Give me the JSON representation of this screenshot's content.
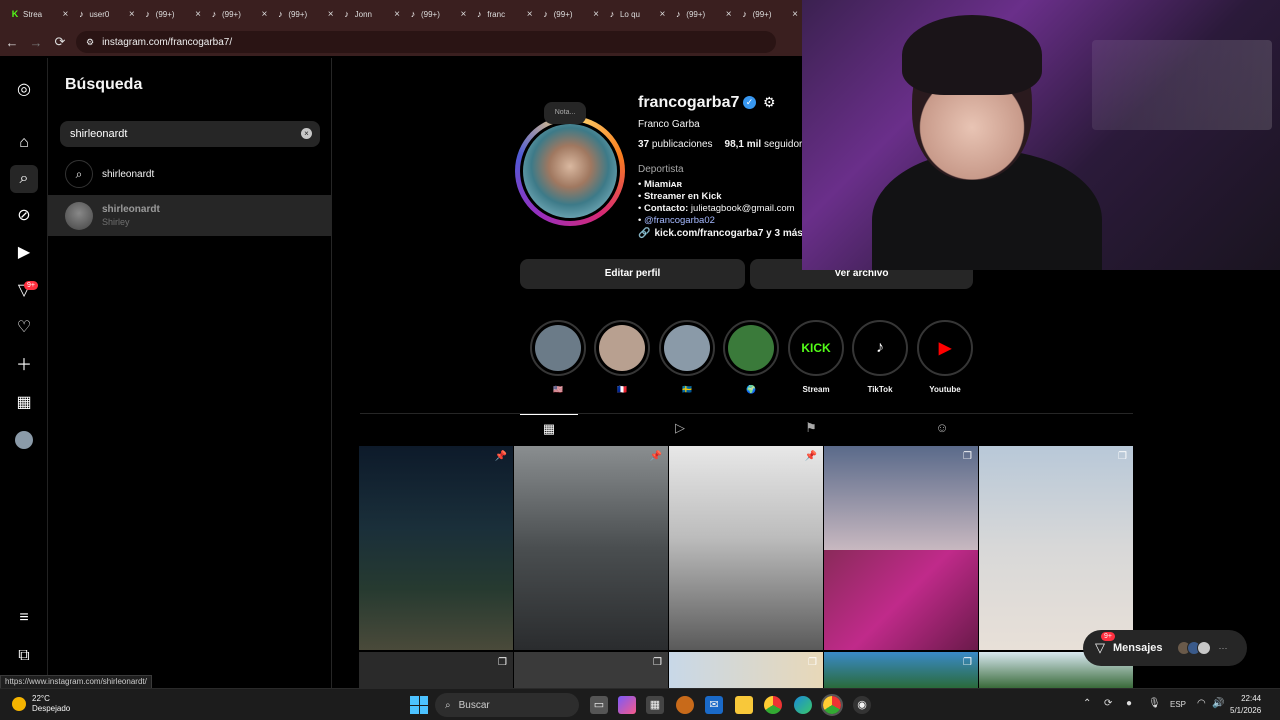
{
  "browser": {
    "tabs": [
      {
        "icon": "K",
        "title": "Strea",
        "kind": "kick"
      },
      {
        "icon": "♪",
        "title": "user0",
        "kind": "tiktok"
      },
      {
        "icon": "♪",
        "title": "(99+)",
        "kind": "tiktok"
      },
      {
        "icon": "♪",
        "title": "(99+)",
        "kind": "tiktok"
      },
      {
        "icon": "♪",
        "title": "(99+)",
        "kind": "tiktok"
      },
      {
        "icon": "♪",
        "title": "Jonn",
        "kind": "tiktok"
      },
      {
        "icon": "♪",
        "title": "(99+)",
        "kind": "tiktok"
      },
      {
        "icon": "♪",
        "title": "franc",
        "kind": "tiktok"
      },
      {
        "icon": "♪",
        "title": "(99+)",
        "kind": "tiktok"
      },
      {
        "icon": "♪",
        "title": "Lo qu",
        "kind": "tiktok"
      },
      {
        "icon": "♪",
        "title": "(99+)",
        "kind": "tiktok"
      },
      {
        "icon": "♪",
        "title": "(99+)",
        "kind": "tiktok"
      }
    ],
    "url": "instagram.com/francogarba7/",
    "status_link": "https://www.instagram.com/shirleonardt/"
  },
  "rail": {
    "notifications_badge": "9+"
  },
  "search": {
    "title": "Búsqueda",
    "query": "shirleonardt",
    "results": [
      {
        "label": "shirleonardt"
      },
      {
        "name": "shirleonardt",
        "subtitle": "Shirley"
      }
    ]
  },
  "profile": {
    "note": "Nota...",
    "username": "francogarba7",
    "full_name": "Franco Garba",
    "posts": "37",
    "posts_label": "publicaciones",
    "followers": "98,1 mil",
    "followers_label": "seguidores",
    "category": "Deportista",
    "bio": [
      {
        "bullet": "•",
        "bold": "Miamiᴀʀ",
        "rest": ""
      },
      {
        "bullet": "•",
        "bold": "Streamer en Kick",
        "rest": ""
      },
      {
        "bullet": "•",
        "bold": "Contacto:",
        "rest": " julietagbook@gmail.com"
      }
    ],
    "mention_bullet": "•",
    "mention": "@francogarba02",
    "link": "kick.com/francogarba7 y 3 más",
    "edit_label": "Editar perfil",
    "archive_label": "Ver archivo",
    "highlights": [
      {
        "label": "🇺🇸",
        "color": "#6b7b88"
      },
      {
        "label": "🇫🇷",
        "color": "#b8a090"
      },
      {
        "label": "🇸🇪",
        "color": "#8a9aa8"
      },
      {
        "label": "🌍",
        "color": "#3a7a3a"
      },
      {
        "label": "Stream",
        "color": "#000000",
        "text": "KICK"
      },
      {
        "label": "TikTok",
        "color": "#000000",
        "text": "♪"
      },
      {
        "label": "Youtube",
        "color": "#000000",
        "text": "▶"
      }
    ]
  },
  "messages": {
    "label": "Mensajes",
    "badge": "9+"
  },
  "taskbar": {
    "temp": "22°C",
    "weather": "Despejado",
    "search_placeholder": "Buscar",
    "lang": "ESP",
    "time": "22:44",
    "date": "5/1/2026"
  }
}
